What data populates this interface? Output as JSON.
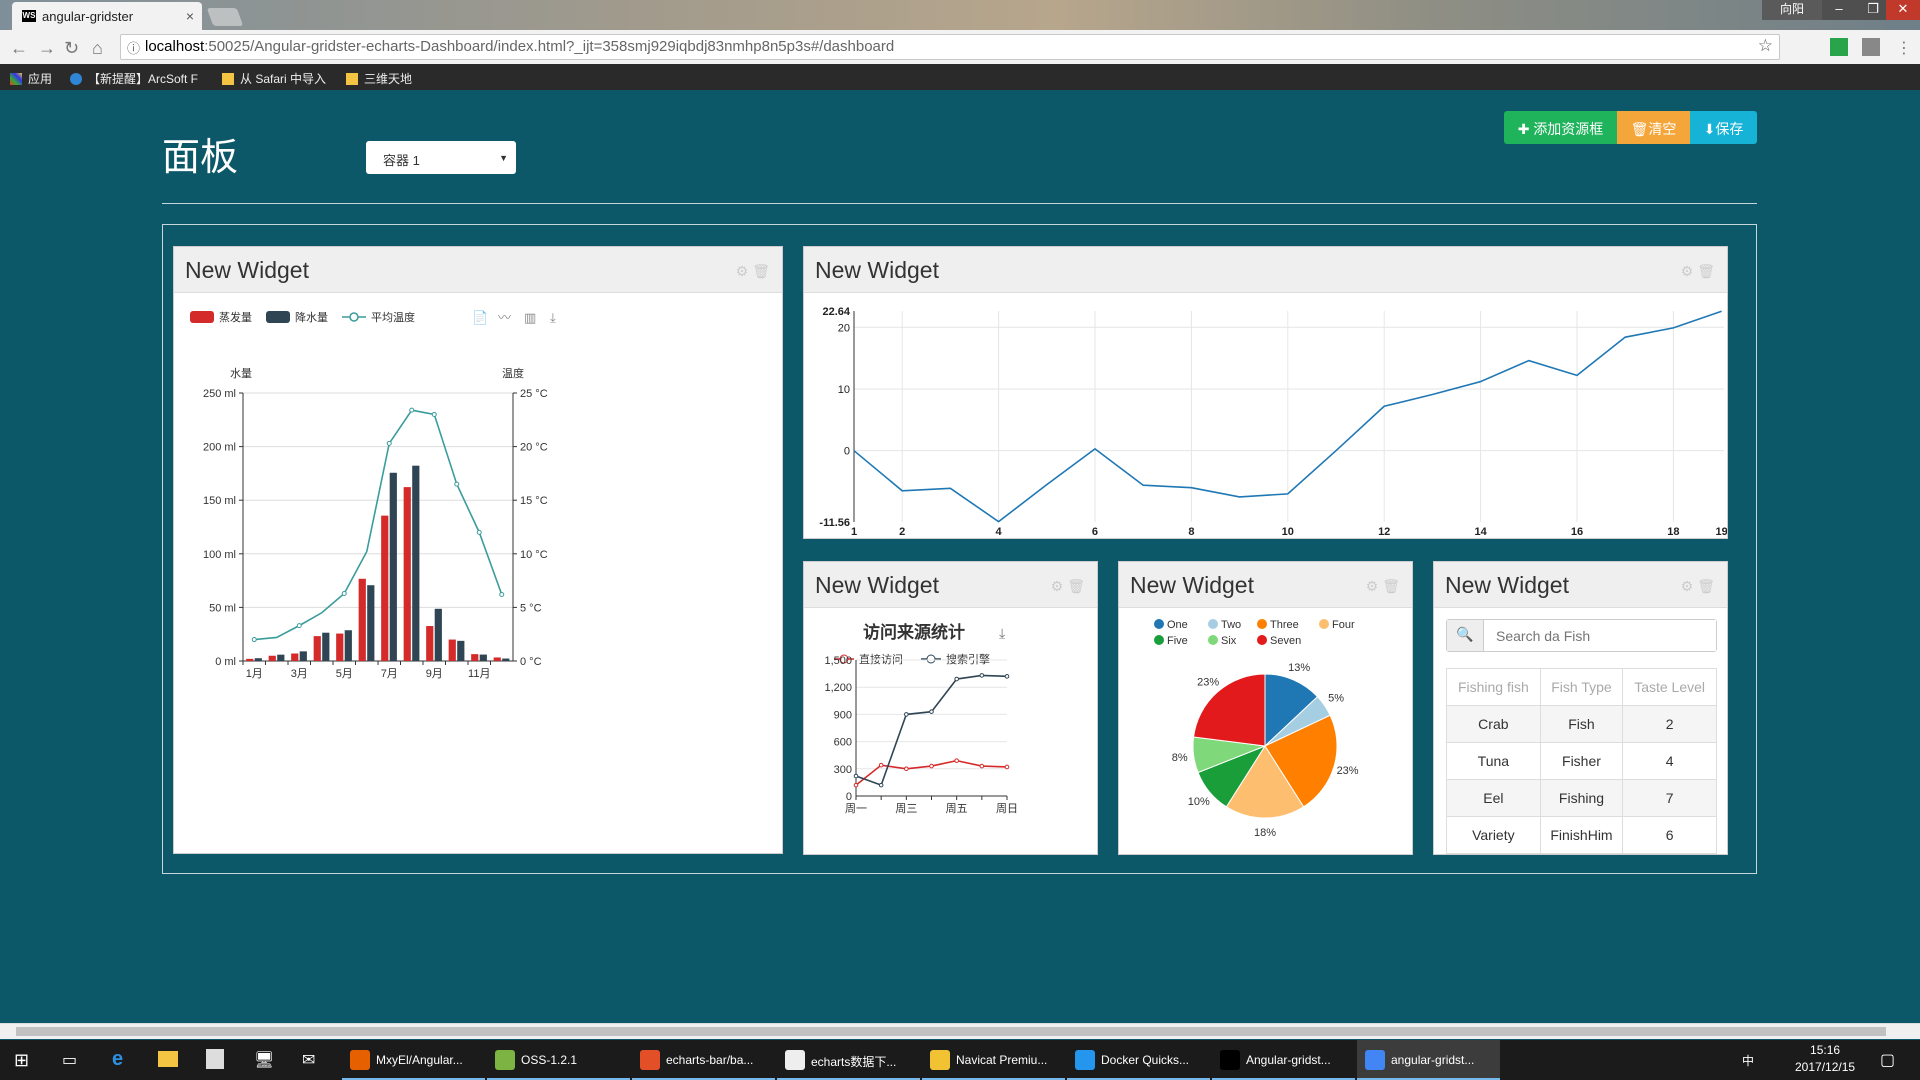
{
  "browser": {
    "tab_title": "angular-gridster",
    "tab_close": "×",
    "user_label": "向阳",
    "url_host": "localhost",
    "url_rest": ":50025/Angular-gridster-echarts-Dashboard/index.html?_ijt=358smj929iqbdj83nmhp8n5p3s#/dashboard",
    "bookmarks": [
      {
        "label": "应用",
        "icon": "apps-grid-icon"
      },
      {
        "label": "【新提醒】ArcSoft F",
        "icon": "arcsoft-icon"
      },
      {
        "label": "从 Safari 中导入",
        "icon": "folder-icon"
      },
      {
        "label": "三维天地",
        "icon": "folder-icon"
      }
    ]
  },
  "page": {
    "title": "面板",
    "container_select": "容器 1",
    "buttons": {
      "add": "添加资源框",
      "clear": "清空",
      "save": "保存"
    }
  },
  "widgets": {
    "w1": {
      "title": "New Widget"
    },
    "w2": {
      "title": "New Widget"
    },
    "w3": {
      "title": "New Widget"
    },
    "w4": {
      "title": "New Widget"
    },
    "w5": {
      "title": "New Widget"
    }
  },
  "chart_data": [
    {
      "type": "bar",
      "legend": [
        "蒸发量",
        "降水量",
        "平均温度"
      ],
      "ylabel_left": "水量",
      "ylabel_right": "温度",
      "categories": [
        "1月",
        "2月",
        "3月",
        "4月",
        "5月",
        "6月",
        "7月",
        "8月",
        "9月",
        "10月",
        "11月",
        "12月"
      ],
      "x_tick_labels": [
        "1月",
        "3月",
        "5月",
        "7月",
        "9月",
        "11月"
      ],
      "y_ticks_left": [
        "250 ml",
        "200 ml",
        "150 ml",
        "100 ml",
        "50 ml",
        "0 ml"
      ],
      "y_ticks_right": [
        "25 °C",
        "20 °C",
        "15 °C",
        "10 °C",
        "5 °C",
        "0 °C"
      ],
      "ylim_left": [
        0,
        250
      ],
      "ylim_right": [
        0,
        25
      ],
      "series": [
        {
          "name": "蒸发量",
          "kind": "bar",
          "color": "#d42a2a",
          "values": [
            2.0,
            4.9,
            7.0,
            23.2,
            25.6,
            76.7,
            135.6,
            162.2,
            32.6,
            20.0,
            6.4,
            3.3
          ]
        },
        {
          "name": "降水量",
          "kind": "bar",
          "color": "#2f4554",
          "values": [
            2.6,
            5.9,
            9.0,
            26.4,
            28.7,
            70.7,
            175.6,
            182.2,
            48.7,
            18.8,
            6.0,
            2.3
          ]
        },
        {
          "name": "平均温度",
          "kind": "line",
          "color": "#3b9c9c",
          "values": [
            2.0,
            2.2,
            3.3,
            4.5,
            6.3,
            10.2,
            20.3,
            23.4,
            23.0,
            16.5,
            12.0,
            6.2
          ]
        }
      ]
    },
    {
      "type": "line",
      "x": [
        1,
        2,
        3,
        4,
        5,
        6,
        7,
        8,
        9,
        10,
        11,
        12,
        13,
        14,
        15,
        16,
        17,
        18,
        19
      ],
      "x_tick_labels": [
        "1",
        "2",
        "4",
        "6",
        "8",
        "10",
        "12",
        "14",
        "16",
        "18",
        "19"
      ],
      "y_tick_labels": [
        "22.64",
        "20",
        "10",
        "0",
        "-11.56"
      ],
      "ylim": [
        -11.56,
        22.64
      ],
      "series": [
        {
          "color": "#1f78b4",
          "values": [
            0,
            -6.5,
            -6.1,
            -11.5,
            -5.5,
            0.3,
            -5.6,
            -6.0,
            -7.5,
            -7.0,
            0,
            7.2,
            9.1,
            11.2,
            14.6,
            12.2,
            18.4,
            19.9,
            22.6
          ]
        }
      ]
    },
    {
      "type": "line",
      "title": "访问来源统计",
      "legend": [
        "直接访问",
        "搜索引擎"
      ],
      "categories": [
        "周一",
        "周二",
        "周三",
        "周四",
        "周五",
        "周六",
        "周日"
      ],
      "x_tick_labels": [
        "周一",
        "周三",
        "周五",
        "周日"
      ],
      "y_tick_labels": [
        "1,500",
        "1,200",
        "900",
        "600",
        "300",
        "0"
      ],
      "ylim": [
        0,
        1500
      ],
      "series": [
        {
          "name": "直接访问",
          "color": "#d42a2a",
          "values": [
            120,
            340,
            300,
            330,
            390,
            330,
            320
          ]
        },
        {
          "name": "搜索引擎",
          "color": "#2f4554",
          "values": [
            220,
            120,
            900,
            930,
            1290,
            1330,
            1320
          ]
        }
      ]
    },
    {
      "type": "pie",
      "legend": [
        "One",
        "Two",
        "Three",
        "Four",
        "Five",
        "Six",
        "Seven"
      ],
      "slices": [
        {
          "name": "One",
          "value": 13,
          "label": "13%",
          "color": "#1f78b4"
        },
        {
          "name": "Two",
          "value": 5,
          "label": "5%",
          "color": "#a6cee3"
        },
        {
          "name": "Three",
          "value": 23,
          "label": "23%",
          "color": "#ff7f00"
        },
        {
          "name": "Four",
          "value": 18,
          "label": "18%",
          "color": "#fdbf6f"
        },
        {
          "name": "Five",
          "value": 10,
          "label": "10%",
          "color": "#1a9e3a"
        },
        {
          "name": "Six",
          "value": 8,
          "label": "8%",
          "color": "#7fd97b"
        },
        {
          "name": "Seven",
          "value": 23,
          "label": "23%",
          "color": "#e31a1c"
        }
      ]
    }
  ],
  "fish_table": {
    "search_placeholder": "Search da Fish",
    "headers": [
      "Fishing fish",
      "Fish Type",
      "Taste Level"
    ],
    "rows": [
      [
        "Crab",
        "Fish",
        "2"
      ],
      [
        "Tuna",
        "Fisher",
        "4"
      ],
      [
        "Eel",
        "Fishing",
        "7"
      ],
      [
        "Variety",
        "FinishHim",
        "6"
      ]
    ]
  },
  "taskbar": {
    "items": [
      {
        "label": "MxyEl/Angular...",
        "color": "#e66000"
      },
      {
        "label": "OSS-1.2.1",
        "color": "#7cb342"
      },
      {
        "label": "echarts-bar/ba...",
        "color": "#e34f26"
      },
      {
        "label": "echarts数据下...",
        "color": "#eeeeee"
      },
      {
        "label": "Navicat Premiu...",
        "color": "#f1c232"
      },
      {
        "label": "Docker Quicks...",
        "color": "#2496ed"
      },
      {
        "label": "Angular-gridst...",
        "color": "#000000"
      },
      {
        "label": "angular-gridst...",
        "color": "#4285f4"
      }
    ],
    "ime": "中",
    "time": "15:16",
    "date": "2017/12/15"
  }
}
